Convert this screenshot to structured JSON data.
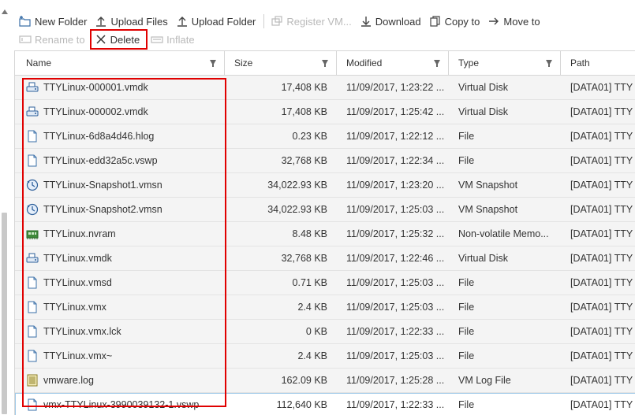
{
  "toolbar": {
    "row1": [
      {
        "label": "New Folder",
        "icon": "new-folder-icon",
        "enabled": true
      },
      {
        "label": "Upload Files",
        "icon": "upload-icon",
        "enabled": true
      },
      {
        "label": "Upload Folder",
        "icon": "upload-folder-icon",
        "enabled": true
      },
      {
        "label": "Register VM...",
        "icon": "register-vm-icon",
        "enabled": false
      },
      {
        "label": "Download",
        "icon": "download-icon",
        "enabled": true
      },
      {
        "label": "Copy to",
        "icon": "copy-icon",
        "enabled": true
      },
      {
        "label": "Move to",
        "icon": "move-icon",
        "enabled": true
      }
    ],
    "row2": [
      {
        "label": "Rename to",
        "icon": "rename-icon",
        "enabled": false
      },
      {
        "label": "Delete",
        "icon": "delete-icon",
        "enabled": true,
        "highlighted": true
      },
      {
        "label": "Inflate",
        "icon": "inflate-icon",
        "enabled": false
      }
    ]
  },
  "columns": {
    "name": "Name",
    "size": "Size",
    "modified": "Modified",
    "type": "Type",
    "path": "Path"
  },
  "files": [
    {
      "name": "TTYLinux-000001.vmdk",
      "size": "17,408 KB",
      "modified": "11/09/2017, 1:23:22 ...",
      "type": "Virtual Disk",
      "path": "[DATA01] TTY",
      "icon": "virtual-disk-icon"
    },
    {
      "name": "TTYLinux-000002.vmdk",
      "size": "17,408 KB",
      "modified": "11/09/2017, 1:25:42 ...",
      "type": "Virtual Disk",
      "path": "[DATA01] TTY",
      "icon": "virtual-disk-icon"
    },
    {
      "name": "TTYLinux-6d8a4d46.hlog",
      "size": "0.23 KB",
      "modified": "11/09/2017, 1:22:12 ...",
      "type": "File",
      "path": "[DATA01] TTY",
      "icon": "file-icon"
    },
    {
      "name": "TTYLinux-edd32a5c.vswp",
      "size": "32,768 KB",
      "modified": "11/09/2017, 1:22:34 ...",
      "type": "File",
      "path": "[DATA01] TTY",
      "icon": "file-icon"
    },
    {
      "name": "TTYLinux-Snapshot1.vmsn",
      "size": "34,022.93 KB",
      "modified": "11/09/2017, 1:23:20 ...",
      "type": "VM Snapshot",
      "path": "[DATA01] TTY",
      "icon": "snapshot-icon"
    },
    {
      "name": "TTYLinux-Snapshot2.vmsn",
      "size": "34,022.93 KB",
      "modified": "11/09/2017, 1:25:03 ...",
      "type": "VM Snapshot",
      "path": "[DATA01] TTY",
      "icon": "snapshot-icon"
    },
    {
      "name": "TTYLinux.nvram",
      "size": "8.48 KB",
      "modified": "11/09/2017, 1:25:32 ...",
      "type": "Non-volatile Memo...",
      "path": "[DATA01] TTY",
      "icon": "nvram-icon"
    },
    {
      "name": "TTYLinux.vmdk",
      "size": "32,768 KB",
      "modified": "11/09/2017, 1:22:46 ...",
      "type": "Virtual Disk",
      "path": "[DATA01] TTY",
      "icon": "virtual-disk-icon"
    },
    {
      "name": "TTYLinux.vmsd",
      "size": "0.71 KB",
      "modified": "11/09/2017, 1:25:03 ...",
      "type": "File",
      "path": "[DATA01] TTY",
      "icon": "file-icon"
    },
    {
      "name": "TTYLinux.vmx",
      "size": "2.4 KB",
      "modified": "11/09/2017, 1:25:03 ...",
      "type": "File",
      "path": "[DATA01] TTY",
      "icon": "file-icon"
    },
    {
      "name": "TTYLinux.vmx.lck",
      "size": "0 KB",
      "modified": "11/09/2017, 1:22:33 ...",
      "type": "File",
      "path": "[DATA01] TTY",
      "icon": "file-icon"
    },
    {
      "name": "TTYLinux.vmx~",
      "size": "2.4 KB",
      "modified": "11/09/2017, 1:25:03 ...",
      "type": "File",
      "path": "[DATA01] TTY",
      "icon": "file-icon"
    },
    {
      "name": "vmware.log",
      "size": "162.09 KB",
      "modified": "11/09/2017, 1:25:28 ...",
      "type": "VM Log File",
      "path": "[DATA01] TTY",
      "icon": "log-file-icon"
    },
    {
      "name": "vmx-TTYLinux-3990039132-1.vswp",
      "size": "112,640 KB",
      "modified": "11/09/2017, 1:22:33 ...",
      "type": "File",
      "path": "[DATA01] TTY",
      "icon": "file-icon",
      "selected": true
    }
  ],
  "colors": {
    "highlight": "#e00000",
    "selection_border": "#9fc9e8"
  }
}
